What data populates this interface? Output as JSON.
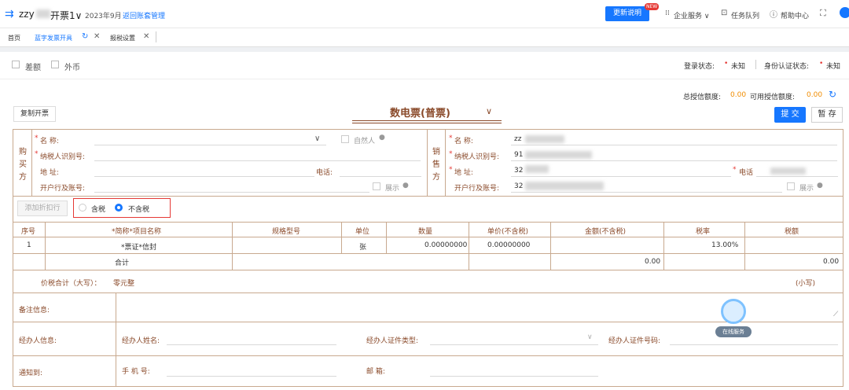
{
  "topbar": {
    "company": "zzy",
    "app_title": "开票1∨",
    "period": "2023年9月",
    "back_link": "返回账套管理",
    "update_btn": "更新说明",
    "new_badge": "NEW",
    "enterprise": "企业服务 ∨",
    "task_queue": "任务队列",
    "help": "帮助中心"
  },
  "tabs": [
    {
      "label": "首页"
    },
    {
      "label": "蓝字发票开具"
    },
    {
      "label": "报税设置"
    }
  ],
  "options": {
    "diff_tax": "差额",
    "foreign": "外币"
  },
  "status": {
    "login_label": "登录状态:",
    "login_value": "未知",
    "auth_label": "身份认证状态:",
    "auth_value": "未知",
    "credit_total_label": "总授信额度:",
    "credit_total_value": "0.00",
    "credit_avail_label": "可用授信额度:",
    "credit_avail_value": "0.00"
  },
  "actions": {
    "copy": "复制开票",
    "submit": "提 交",
    "save": "暂 存"
  },
  "invoice_title": "数电票(普票)",
  "buyer": {
    "side": [
      "购",
      "买",
      "方"
    ],
    "name_label": "名      称:",
    "natural_person": "自然人",
    "tax_id_label": "纳税人识别号:",
    "address_label": "地      址:",
    "phone_label": "电话:",
    "bank_label": "开户行及账号:",
    "show_label": "展示"
  },
  "seller": {
    "side": [
      "销",
      "售",
      "方"
    ],
    "name_label": "名      称:",
    "name_value": "zz",
    "tax_id_label": "纳税人识别号:",
    "tax_id_value": "91",
    "address_label": "地      址:",
    "address_value": "32",
    "phone_label": "电话",
    "bank_label": "开户行及账号:",
    "bank_value": "32",
    "show_label": "展示"
  },
  "discount_btn": "添加折扣行",
  "tax_mode": {
    "inclusive": "含税",
    "exclusive": "不含税"
  },
  "table": {
    "headers": [
      "序号",
      "*简称*项目名称",
      "规格型号",
      "单位",
      "数量",
      "单价(不含税)",
      "金额(不含税)",
      "税率",
      "税额"
    ],
    "row": {
      "no": "1",
      "name": "*票证*信封",
      "spec": "",
      "unit": "张",
      "qty": "0.00000000",
      "price": "0.00000000",
      "amount": "",
      "rate": "13.00%",
      "tax": ""
    },
    "total_label": "合计",
    "total_amount": "0.00",
    "total_tax": "0.00"
  },
  "price_total": {
    "label": "价税合计（大写）：",
    "value": "零元整",
    "small": "(小写)"
  },
  "remarks": {
    "label": "备注信息:"
  },
  "agent": {
    "label": "经办人信息:",
    "name_label": "经办人姓名:",
    "id_type_label": "经办人证件类型:",
    "id_no_label": "经办人证件号码:"
  },
  "notify": {
    "label": "通知到:",
    "mobile_label": "手  机  号:",
    "email_label": "邮        箱:"
  },
  "online_service": "在线服务"
}
